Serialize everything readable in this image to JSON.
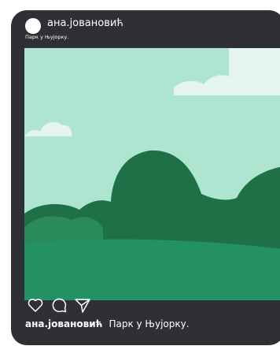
{
  "post": {
    "username": "ана.јовановић",
    "location": "Парк у Њујорку.",
    "caption_author": "ана.јовановић",
    "caption_text": "Парк у Њујорку."
  },
  "actions": {
    "like_icon": "heart-icon",
    "comment_icon": "comment-bubble-icon",
    "share_icon": "paper-plane-icon"
  },
  "colors": {
    "card_background": "#2f3036",
    "sky": "#aee5d1",
    "cloud": "#e3f5ee",
    "tree_dark": "#1f6f47",
    "tree_mid": "#2a8a5a",
    "grass": "#249164"
  }
}
